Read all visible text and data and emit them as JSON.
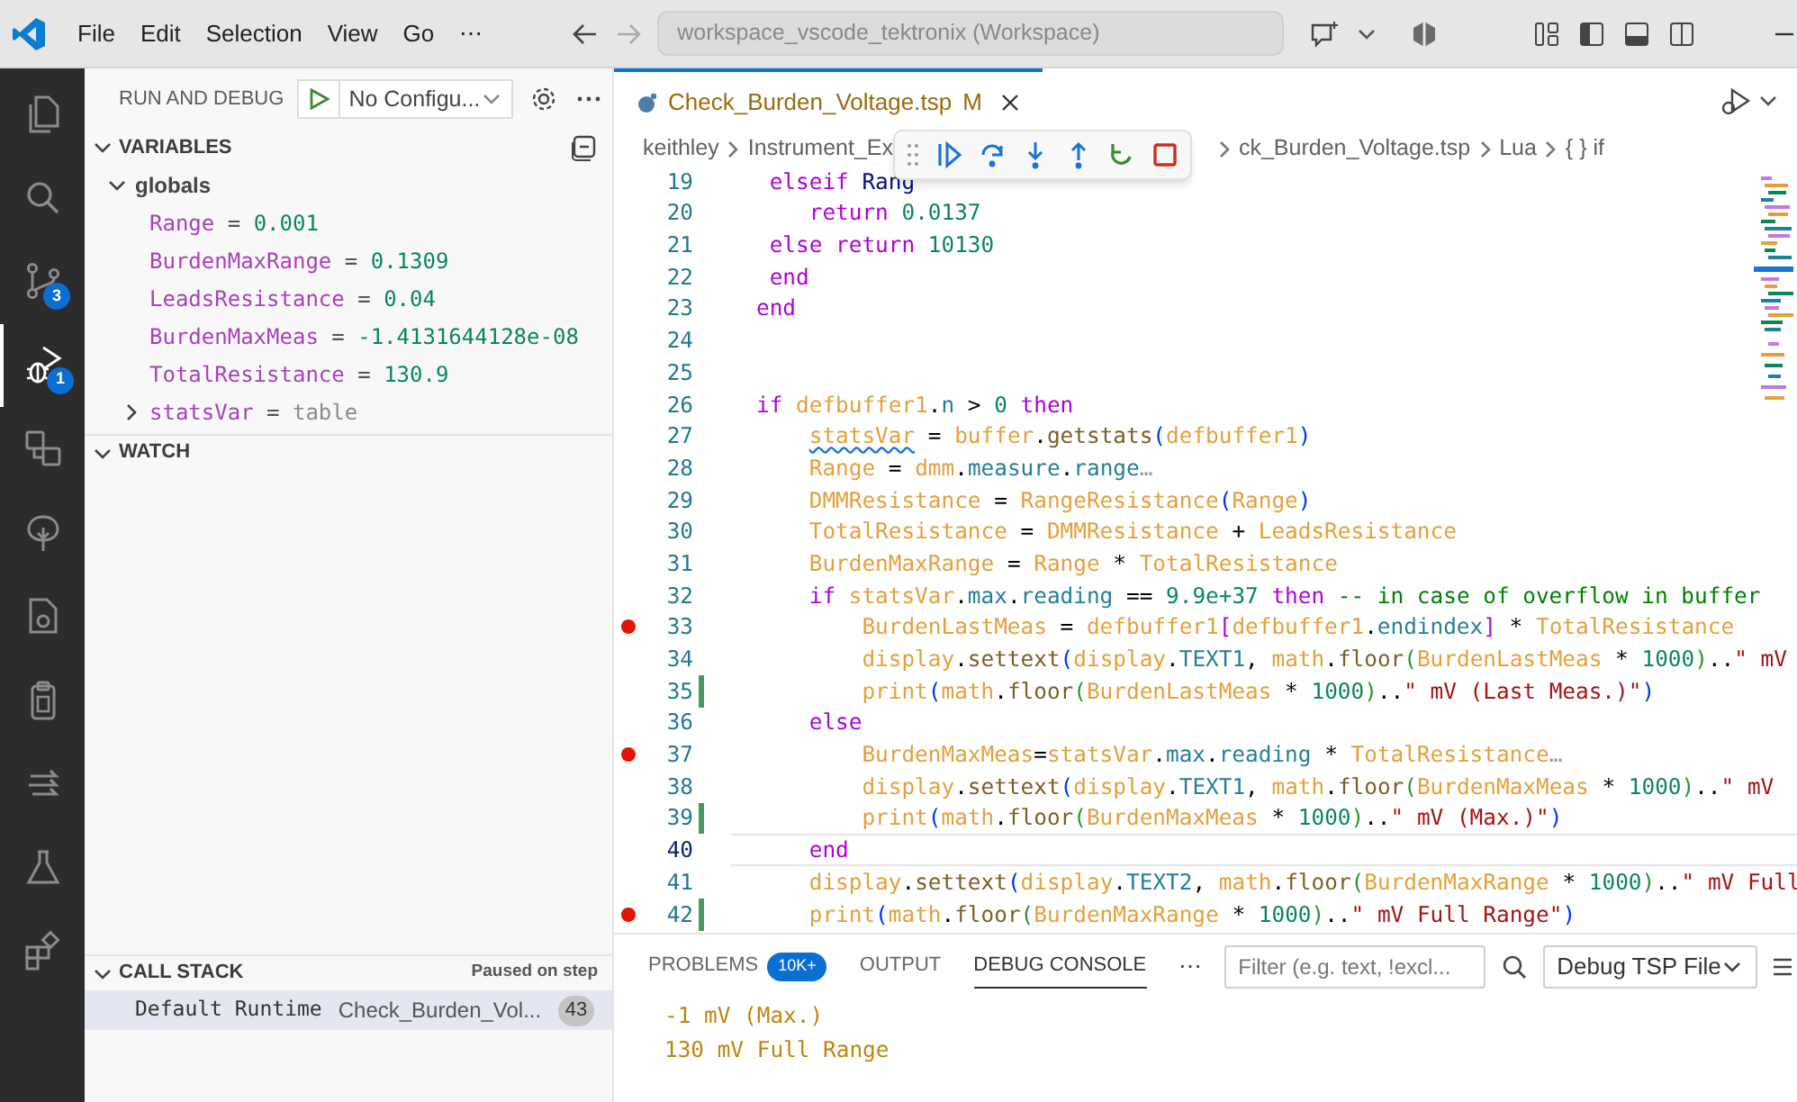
{
  "title_bar": {
    "menu": [
      "File",
      "Edit",
      "Selection",
      "View",
      "Go",
      "⋯"
    ],
    "command_center": "workspace_vscode_tektronix (Workspace)"
  },
  "activity_bar": [
    {
      "selected": false
    },
    {
      "selected": false
    },
    {
      "selected": false,
      "badge": "3"
    },
    {
      "selected": true,
      "badge": "1"
    },
    {
      "selected": false
    },
    {
      "selected": false
    },
    {
      "selected": false
    },
    {
      "selected": false
    },
    {
      "selected": false
    },
    {
      "selected": false
    },
    {
      "selected": false
    }
  ],
  "run_and_debug": {
    "title": "RUN AND DEBUG",
    "configuration": "No Configu..."
  },
  "variables": {
    "title": "VARIABLES",
    "expanded": true,
    "scopes": [
      {
        "name": "globals",
        "expanded": true,
        "children": [
          {
            "name": "Range",
            "separator": "=",
            "value": "0.001",
            "kind": "number"
          },
          {
            "name": "BurdenMaxRange",
            "separator": "=",
            "value": "0.1309",
            "kind": "number"
          },
          {
            "name": "LeadsResistance",
            "separator": "=",
            "value": "0.04",
            "kind": "number"
          },
          {
            "name": "BurdenMaxMeas",
            "separator": "=",
            "value": "-1.4131644128e-08",
            "kind": "number"
          },
          {
            "name": "TotalResistance",
            "separator": "=",
            "value": "130.9",
            "kind": "number"
          },
          {
            "name": "statsVar",
            "separator": "=",
            "value": "table",
            "kind": "object",
            "expanded": false
          }
        ]
      }
    ]
  },
  "watch": {
    "title": "WATCH",
    "expanded": true
  },
  "call_stack": {
    "title": "CALL STACK",
    "expanded": true,
    "status": "Paused on step",
    "frames": [
      {
        "name": "Default Runtime",
        "file": "Check_Burden_Vol...",
        "line": "43",
        "selected": true
      }
    ]
  },
  "editor": {
    "tabs": [
      {
        "label": "Check_Burden_Voltage.tsp",
        "badge": "M",
        "selected": true
      }
    ],
    "breadcrumb": [
      "keithley",
      "Instrument_Ex",
      "ck_Burden_Voltage.tsp",
      "Lua",
      "{ } if"
    ],
    "lines": [
      {
        "number": "19",
        "breakpoint": false,
        "modified": false,
        "current": false,
        "tokens": [
          {
            "kind": "kw",
            "text": " elseif "
          },
          {
            "kind": "v2",
            "text": "Rang"
          }
        ]
      },
      {
        "number": "20",
        "breakpoint": false,
        "modified": false,
        "current": false,
        "tokens": [
          {
            "kind": "kw",
            "text": "    return "
          },
          {
            "kind": "num",
            "text": "0.0137"
          }
        ]
      },
      {
        "number": "21",
        "breakpoint": false,
        "modified": false,
        "current": false,
        "tokens": [
          {
            "kind": "kw",
            "text": " else return "
          },
          {
            "kind": "num",
            "text": "10130"
          }
        ]
      },
      {
        "number": "22",
        "breakpoint": false,
        "modified": false,
        "current": false,
        "tokens": [
          {
            "kind": "kw",
            "text": " end"
          }
        ]
      },
      {
        "number": "23",
        "breakpoint": false,
        "modified": false,
        "current": false,
        "tokens": [
          {
            "kind": "kw",
            "text": "end"
          }
        ]
      },
      {
        "number": "24",
        "breakpoint": false,
        "modified": false,
        "current": false
      },
      {
        "number": "25",
        "breakpoint": false,
        "modified": false,
        "current": false
      },
      {
        "number": "26",
        "breakpoint": false,
        "modified": false,
        "current": false,
        "tokens": [
          {
            "kind": "kw",
            "text": "if "
          },
          {
            "kind": "var",
            "text": "defbuffer1"
          },
          {
            "kind": "t",
            "text": "."
          },
          {
            "kind": "fld",
            "text": "n"
          },
          {
            "kind": "t",
            "text": " > "
          },
          {
            "kind": "num",
            "text": "0 "
          },
          {
            "kind": "kw",
            "text": "then"
          }
        ]
      },
      {
        "number": "27",
        "breakpoint": false,
        "modified": false,
        "current": false,
        "tokens": [
          {
            "kind": "warn",
            "text": "    statsVar"
          },
          {
            "kind": "t",
            "text": " = "
          },
          {
            "kind": "var",
            "text": "buffer"
          },
          {
            "kind": "t",
            "text": "."
          },
          {
            "kind": "fn",
            "text": "getstats"
          },
          {
            "kind": "p",
            "text": "("
          },
          {
            "kind": "var",
            "text": "defbuffer1"
          },
          {
            "kind": "p",
            "text": ")"
          }
        ]
      },
      {
        "number": "28",
        "breakpoint": false,
        "modified": false,
        "current": false,
        "tokens": [
          {
            "kind": "var",
            "text": "    Range"
          },
          {
            "kind": "t",
            "text": " = "
          },
          {
            "kind": "var",
            "text": "dmm"
          },
          {
            "kind": "t",
            "text": "."
          },
          {
            "kind": "fld",
            "text": "measure"
          },
          {
            "kind": "t",
            "text": "."
          },
          {
            "kind": "fld",
            "text": "range"
          },
          {
            "kind": "hint",
            "text": "…"
          }
        ]
      },
      {
        "number": "29",
        "breakpoint": false,
        "modified": false,
        "current": false,
        "tokens": [
          {
            "kind": "var",
            "text": "    DMMResistance"
          },
          {
            "kind": "t",
            "text": " = "
          },
          {
            "kind": "var",
            "text": "RangeResistance"
          },
          {
            "kind": "p",
            "text": "("
          },
          {
            "kind": "var",
            "text": "Range"
          },
          {
            "kind": "p",
            "text": ")"
          }
        ]
      },
      {
        "number": "30",
        "breakpoint": false,
        "modified": false,
        "current": false,
        "tokens": [
          {
            "kind": "var",
            "text": "    TotalResistance"
          },
          {
            "kind": "t",
            "text": " = "
          },
          {
            "kind": "var",
            "text": "DMMResistance"
          },
          {
            "kind": "t",
            "text": " + "
          },
          {
            "kind": "var",
            "text": "LeadsResistance"
          }
        ]
      },
      {
        "number": "31",
        "breakpoint": false,
        "modified": false,
        "current": false,
        "tokens": [
          {
            "kind": "var",
            "text": "    BurdenMaxRange"
          },
          {
            "kind": "t",
            "text": " = "
          },
          {
            "kind": "var",
            "text": "Range"
          },
          {
            "kind": "t",
            "text": " * "
          },
          {
            "kind": "var",
            "text": "TotalResistance"
          }
        ]
      },
      {
        "number": "32",
        "breakpoint": false,
        "modified": false,
        "current": false,
        "tokens": [
          {
            "kind": "kw",
            "text": "    if "
          },
          {
            "kind": "var",
            "text": "statsVar"
          },
          {
            "kind": "t",
            "text": "."
          },
          {
            "kind": "fld",
            "text": "max"
          },
          {
            "kind": "t",
            "text": "."
          },
          {
            "kind": "fld",
            "text": "reading"
          },
          {
            "kind": "t",
            "text": " == "
          },
          {
            "kind": "num",
            "text": "9.9e+37 "
          },
          {
            "kind": "kw",
            "text": "then "
          },
          {
            "kind": "cmt",
            "text": "-- in case of overflow in buffer"
          }
        ]
      },
      {
        "number": "33",
        "breakpoint": true,
        "modified": false,
        "current": false,
        "tokens": [
          {
            "kind": "var",
            "text": "        BurdenLastMeas"
          },
          {
            "kind": "t",
            "text": " = "
          },
          {
            "kind": "var",
            "text": "defbuffer1"
          },
          {
            "kind": "br",
            "text": "["
          },
          {
            "kind": "var",
            "text": "defbuffer1"
          },
          {
            "kind": "t",
            "text": "."
          },
          {
            "kind": "fld",
            "text": "endindex"
          },
          {
            "kind": "br",
            "text": "]"
          },
          {
            "kind": "t",
            "text": " * "
          },
          {
            "kind": "var",
            "text": "TotalResistance"
          }
        ]
      },
      {
        "number": "34",
        "breakpoint": false,
        "modified": false,
        "current": false,
        "tokens": [
          {
            "kind": "var",
            "text": "        display"
          },
          {
            "kind": "t",
            "text": "."
          },
          {
            "kind": "fn",
            "text": "settext"
          },
          {
            "kind": "p",
            "text": "("
          },
          {
            "kind": "var",
            "text": "display"
          },
          {
            "kind": "t",
            "text": "."
          },
          {
            "kind": "fld",
            "text": "TEXT1"
          },
          {
            "kind": "t",
            "text": ", "
          },
          {
            "kind": "var",
            "text": "math"
          },
          {
            "kind": "t",
            "text": "."
          },
          {
            "kind": "fn",
            "text": "floor"
          },
          {
            "kind": "p2",
            "text": "("
          },
          {
            "kind": "var",
            "text": "BurdenLastMeas"
          },
          {
            "kind": "t",
            "text": " * "
          },
          {
            "kind": "num",
            "text": "1000"
          },
          {
            "kind": "p2",
            "text": ")"
          },
          {
            "kind": "t",
            "text": ".."
          },
          {
            "kind": "str",
            "text": "\" mV"
          }
        ]
      },
      {
        "number": "35",
        "breakpoint": false,
        "modified": true,
        "current": false,
        "tokens": [
          {
            "kind": "var",
            "text": "        print"
          },
          {
            "kind": "p",
            "text": "("
          },
          {
            "kind": "var",
            "text": "math"
          },
          {
            "kind": "t",
            "text": "."
          },
          {
            "kind": "fn",
            "text": "floor"
          },
          {
            "kind": "p2",
            "text": "("
          },
          {
            "kind": "var",
            "text": "BurdenLastMeas"
          },
          {
            "kind": "t",
            "text": " * "
          },
          {
            "kind": "num",
            "text": "1000"
          },
          {
            "kind": "p2",
            "text": ")"
          },
          {
            "kind": "t",
            "text": ".."
          },
          {
            "kind": "str",
            "text": "\" mV (Last Meas.)\""
          },
          {
            "kind": "p",
            "text": ")"
          }
        ]
      },
      {
        "number": "36",
        "breakpoint": false,
        "modified": false,
        "current": false,
        "tokens": [
          {
            "kind": "kw",
            "text": "    else"
          }
        ]
      },
      {
        "number": "37",
        "breakpoint": true,
        "modified": false,
        "current": false,
        "tokens": [
          {
            "kind": "var",
            "text": "        BurdenMaxMeas"
          },
          {
            "kind": "t",
            "text": "="
          },
          {
            "kind": "var",
            "text": "statsVar"
          },
          {
            "kind": "t",
            "text": "."
          },
          {
            "kind": "fld",
            "text": "max"
          },
          {
            "kind": "t",
            "text": "."
          },
          {
            "kind": "fld",
            "text": "reading"
          },
          {
            "kind": "t",
            "text": " * "
          },
          {
            "kind": "var",
            "text": "TotalResistance"
          },
          {
            "kind": "hint",
            "text": "…"
          }
        ]
      },
      {
        "number": "38",
        "breakpoint": false,
        "modified": false,
        "current": false,
        "tokens": [
          {
            "kind": "var",
            "text": "        display"
          },
          {
            "kind": "t",
            "text": "."
          },
          {
            "kind": "fn",
            "text": "settext"
          },
          {
            "kind": "p",
            "text": "("
          },
          {
            "kind": "var",
            "text": "display"
          },
          {
            "kind": "t",
            "text": "."
          },
          {
            "kind": "fld",
            "text": "TEXT1"
          },
          {
            "kind": "t",
            "text": ", "
          },
          {
            "kind": "var",
            "text": "math"
          },
          {
            "kind": "t",
            "text": "."
          },
          {
            "kind": "fn",
            "text": "floor"
          },
          {
            "kind": "p2",
            "text": "("
          },
          {
            "kind": "var",
            "text": "BurdenMaxMeas"
          },
          {
            "kind": "t",
            "text": " * "
          },
          {
            "kind": "num",
            "text": "1000"
          },
          {
            "kind": "p2",
            "text": ")"
          },
          {
            "kind": "t",
            "text": ".."
          },
          {
            "kind": "str",
            "text": "\" mV"
          }
        ]
      },
      {
        "number": "39",
        "breakpoint": false,
        "modified": true,
        "current": false,
        "tokens": [
          {
            "kind": "var",
            "text": "        print"
          },
          {
            "kind": "p",
            "text": "("
          },
          {
            "kind": "var",
            "text": "math"
          },
          {
            "kind": "t",
            "text": "."
          },
          {
            "kind": "fn",
            "text": "floor"
          },
          {
            "kind": "p2",
            "text": "("
          },
          {
            "kind": "var",
            "text": "BurdenMaxMeas"
          },
          {
            "kind": "t",
            "text": " * "
          },
          {
            "kind": "num",
            "text": "1000"
          },
          {
            "kind": "p2",
            "text": ")"
          },
          {
            "kind": "t",
            "text": ".."
          },
          {
            "kind": "str",
            "text": "\" mV (Max.)\""
          },
          {
            "kind": "p",
            "text": ")"
          }
        ]
      },
      {
        "number": "40",
        "breakpoint": false,
        "modified": false,
        "current": true,
        "tokens": [
          {
            "kind": "kw",
            "text": "    end"
          }
        ]
      },
      {
        "number": "41",
        "breakpoint": false,
        "modified": false,
        "current": false,
        "tokens": [
          {
            "kind": "var",
            "text": "    display"
          },
          {
            "kind": "t",
            "text": "."
          },
          {
            "kind": "fn",
            "text": "settext"
          },
          {
            "kind": "p",
            "text": "("
          },
          {
            "kind": "var",
            "text": "display"
          },
          {
            "kind": "t",
            "text": "."
          },
          {
            "kind": "fld",
            "text": "TEXT2"
          },
          {
            "kind": "t",
            "text": ", "
          },
          {
            "kind": "var",
            "text": "math"
          },
          {
            "kind": "t",
            "text": "."
          },
          {
            "kind": "fn",
            "text": "floor"
          },
          {
            "kind": "p2",
            "text": "("
          },
          {
            "kind": "var",
            "text": "BurdenMaxRange"
          },
          {
            "kind": "t",
            "text": " * "
          },
          {
            "kind": "num",
            "text": "1000"
          },
          {
            "kind": "p2",
            "text": ")"
          },
          {
            "kind": "t",
            "text": ".."
          },
          {
            "kind": "str",
            "text": "\" mV Full"
          }
        ]
      },
      {
        "number": "42",
        "breakpoint": true,
        "modified": true,
        "current": false,
        "tokens": [
          {
            "kind": "var",
            "text": "    print"
          },
          {
            "kind": "p",
            "text": "("
          },
          {
            "kind": "var",
            "text": "math"
          },
          {
            "kind": "t",
            "text": "."
          },
          {
            "kind": "fn",
            "text": "floor"
          },
          {
            "kind": "p2",
            "text": "("
          },
          {
            "kind": "var",
            "text": "BurdenMaxRange"
          },
          {
            "kind": "t",
            "text": " * "
          },
          {
            "kind": "num",
            "text": "1000"
          },
          {
            "kind": "p2",
            "text": ")"
          },
          {
            "kind": "t",
            "text": ".."
          },
          {
            "kind": "str",
            "text": "\" mV Full Range\""
          },
          {
            "kind": "p",
            "text": ")"
          }
        ]
      }
    ]
  },
  "panel": {
    "tabs": [
      {
        "label": "PROBLEMS",
        "badge": "10K+",
        "selected": false
      },
      {
        "label": "OUTPUT",
        "selected": false
      },
      {
        "label": "DEBUG CONSOLE",
        "selected": true
      }
    ],
    "more": "⋯",
    "filter": {
      "placeholder": "Filter (e.g. text, !excl..."
    },
    "session": "Debug TSP File",
    "output": [
      "-1 mV (Max.)",
      "130 mV Full Range"
    ]
  }
}
